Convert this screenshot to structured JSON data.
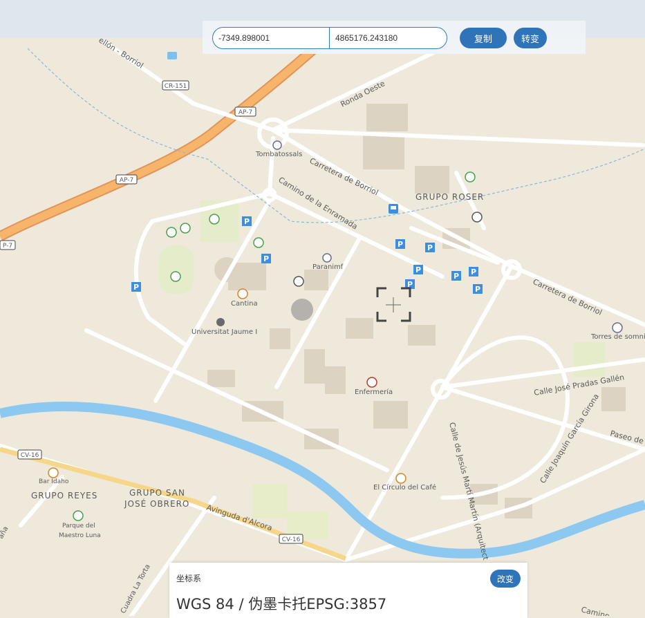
{
  "toolbar": {
    "x_value": "-7349.898001",
    "y_value": "4865176.243180",
    "copy_label": "复制",
    "convert_label": "转变"
  },
  "crs_panel": {
    "label": "坐标系",
    "value": "WGS 84 / 伪墨卡托EPSG:3857",
    "change_label": "改变"
  },
  "map_labels": {
    "road_castellon": "ellón - Borriol",
    "cr151": "CR-151",
    "ap7_a": "AP-7",
    "ap7_b": "AP-7",
    "ap7_c": "P-7",
    "ronda_oeste": "Ronda Oeste",
    "tombatossals": "Tombatossals",
    "carretera_borriol_1": "Carretera de Borriol",
    "carretera_borriol_2": "Carretera de Borriol",
    "grupo_roser": "GRUPO ROSER",
    "camino_enramada": "Camino de la Enramada",
    "paranimf": "Paranimf",
    "cantina": "Cantina",
    "universitat": "Universitat Jaume I",
    "torres_somnis": "Torres de somnis",
    "calle_pradas": "Calle José Pradas Gallén",
    "enfermeria": "Enfermería",
    "paseo": "Paseo de",
    "calle_garcia": "Calle Joaquín García Girona",
    "calle_jesus": "Calle de Jesús Martí Martín (Arquitect",
    "cv16_a": "CV-16",
    "cv16_b": "CV-16",
    "bar_idaho": "Bar Idaho",
    "grupo_reyes": "GRUPO REYES",
    "grupo_san_1": "GRUPO SAN",
    "grupo_san_2": "JOSÉ OBRERO",
    "circulo_cafe": "El Círculo del Café",
    "avinguda_alcora": "Avinguda d'Alcora",
    "parque_1": "Parque del",
    "parque_2": "Maestro Luna",
    "cuadra_torta": "Cuadra La Torta",
    "edge_left": "aña",
    "edge_bottom": "Camino"
  },
  "colors": {
    "accent": "#2f73b9",
    "motorway": "#f4a94d",
    "river": "#7cc0ee",
    "land": "#efe9dc",
    "parking": "#3c8fe0"
  },
  "icons": [
    "parking-icon",
    "sport-icon",
    "bus-icon",
    "cafe-icon",
    "restaurant-icon",
    "education-icon",
    "hospital-icon",
    "park-icon",
    "bar-icon",
    "crosshair-icon"
  ]
}
